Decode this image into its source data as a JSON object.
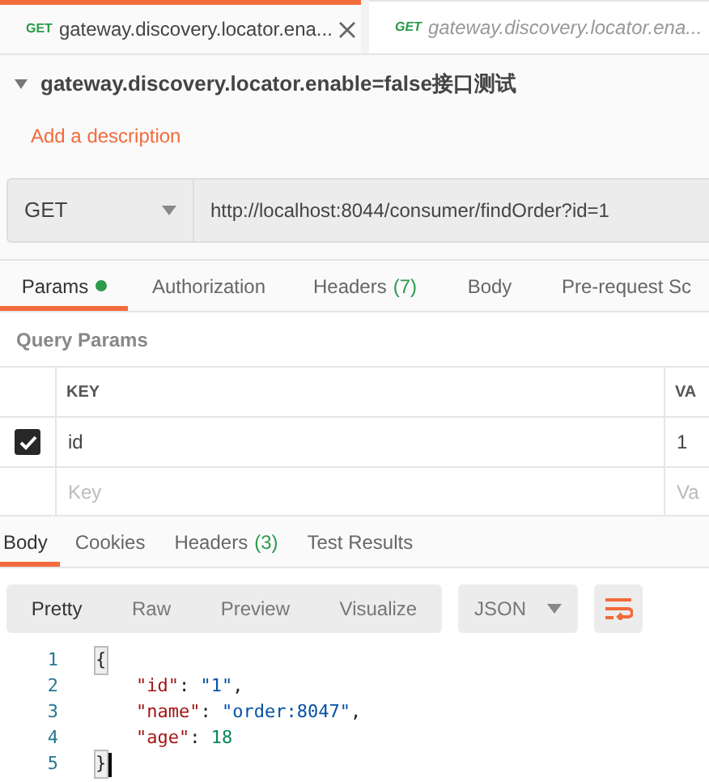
{
  "request_tabs": [
    {
      "method": "GET",
      "title": "gateway.discovery.locator.ena...",
      "selected": true,
      "closable": true
    },
    {
      "method": "GET",
      "title": "gateway.discovery.locator.ena...",
      "selected": false,
      "closable": false
    }
  ],
  "request": {
    "name": "gateway.discovery.locator.enable=false接口测试",
    "description_link": "Add a description",
    "method": "GET",
    "url": "http://localhost:8044/consumer/findOrder?id=1"
  },
  "section_tabs": [
    {
      "label": "Params",
      "dot": true,
      "selected": true
    },
    {
      "label": "Authorization",
      "dot": false,
      "selected": false
    },
    {
      "label": "Headers",
      "count": "(7)",
      "dot": false,
      "selected": false
    },
    {
      "label": "Body",
      "dot": false,
      "selected": false
    },
    {
      "label": "Pre-request Sc",
      "dot": false,
      "selected": false
    }
  ],
  "query_params": {
    "title": "Query Params",
    "columns": [
      "KEY",
      "VA"
    ],
    "rows": [
      {
        "checked": true,
        "key": "id",
        "value": "1"
      }
    ],
    "new_row": {
      "key_placeholder": "Key",
      "value_placeholder": "Va"
    }
  },
  "response_tabs": [
    {
      "label": "Body",
      "selected": true
    },
    {
      "label": "Cookies",
      "selected": false
    },
    {
      "label": "Headers",
      "count": "(3)",
      "selected": false
    },
    {
      "label": "Test Results",
      "selected": false
    }
  ],
  "view_modes": [
    {
      "label": "Pretty",
      "selected": true
    },
    {
      "label": "Raw",
      "selected": false
    },
    {
      "label": "Preview",
      "selected": false
    },
    {
      "label": "Visualize",
      "selected": false
    }
  ],
  "format": "JSON",
  "code_lines": [
    {
      "number": "1",
      "indented": false,
      "cursor": false,
      "tokens": [
        {
          "kind": "bracket",
          "text": "{"
        }
      ]
    },
    {
      "number": "2",
      "indented": true,
      "cursor": false,
      "tokens": [
        {
          "kind": "key",
          "text": "\"id\""
        },
        {
          "kind": "punct",
          "text": ": "
        },
        {
          "kind": "string",
          "text": "\"1\""
        },
        {
          "kind": "punct",
          "text": ","
        }
      ]
    },
    {
      "number": "3",
      "indented": true,
      "cursor": false,
      "tokens": [
        {
          "kind": "key",
          "text": "\"name\""
        },
        {
          "kind": "punct",
          "text": ": "
        },
        {
          "kind": "string",
          "text": "\"order:8047\""
        },
        {
          "kind": "punct",
          "text": ","
        }
      ]
    },
    {
      "number": "4",
      "indented": true,
      "cursor": false,
      "tokens": [
        {
          "kind": "key",
          "text": "\"age\""
        },
        {
          "kind": "punct",
          "text": ": "
        },
        {
          "kind": "number",
          "text": "18"
        }
      ]
    },
    {
      "number": "5",
      "indented": false,
      "cursor": true,
      "tokens": [
        {
          "kind": "bracket",
          "text": "}"
        }
      ]
    }
  ]
}
